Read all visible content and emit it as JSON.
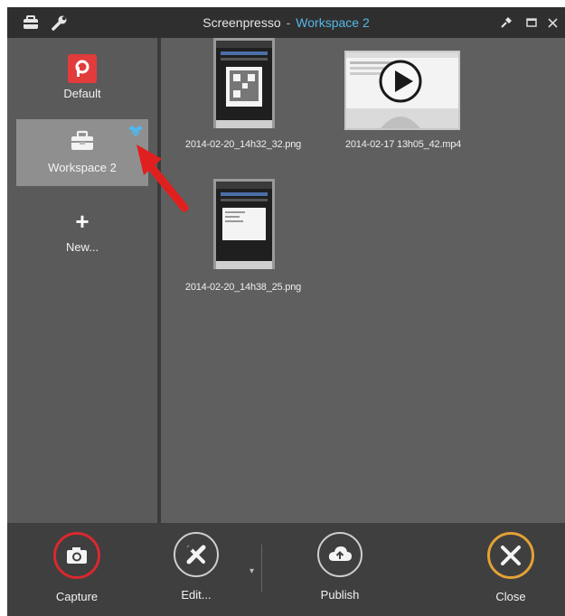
{
  "window": {
    "app_name": "Screenpresso",
    "separator": "-",
    "workspace_name": "Workspace 2",
    "icons": [
      "toolbox-icon",
      "wrench-icon",
      "pin-icon",
      "maximize-icon",
      "close-icon"
    ],
    "accent_color": "#55b8e6"
  },
  "sidebar": {
    "items": [
      {
        "label": "Default",
        "icon": "screenpresso-logo-icon",
        "selected": false
      },
      {
        "label": "Workspace 2",
        "icon": "folder-box-icon",
        "badge_icon": "dropbox-icon",
        "selected": true
      },
      {
        "label": "New...",
        "icon": "plus-icon",
        "selected": false
      }
    ]
  },
  "files": [
    {
      "name": "2014-02-20_14h32_32.png",
      "type": "image"
    },
    {
      "name": "2014-02-17 13h05_42.mp4",
      "type": "video"
    },
    {
      "name": "2014-02-20_14h38_25.png",
      "type": "image"
    }
  ],
  "toolbar": {
    "capture_label": "Capture",
    "edit_label": "Edit...",
    "publish_label": "Publish",
    "close_label": "Close",
    "capture_ring_color": "#d9282f",
    "close_ring_color": "#e3a136"
  }
}
